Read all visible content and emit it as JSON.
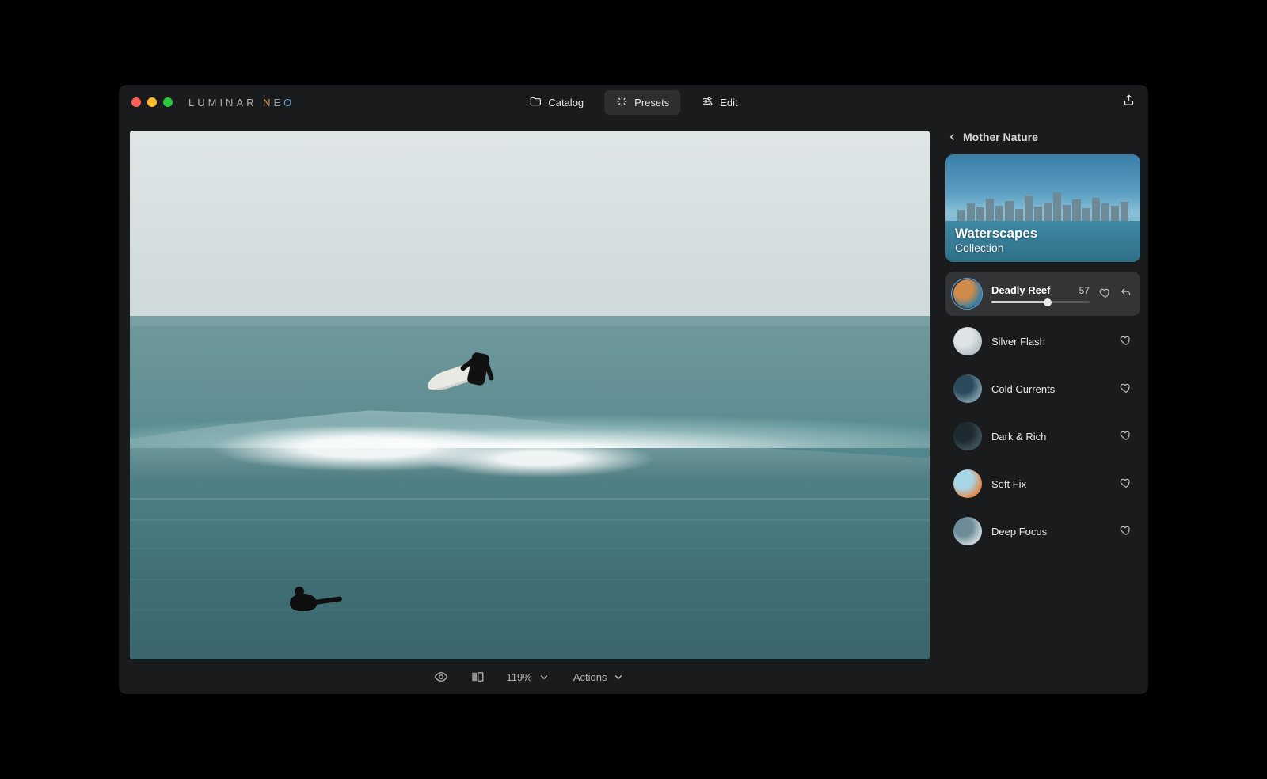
{
  "app": {
    "name": "LUMINAR NEO"
  },
  "tabs": {
    "catalog": "Catalog",
    "presets": "Presets",
    "edit": "Edit",
    "active": "presets"
  },
  "panel": {
    "back_label": "Mother Nature",
    "collection_title": "Waterscapes",
    "collection_subtitle": "Collection"
  },
  "presets": [
    {
      "name": "Deadly Reef",
      "value": 57,
      "selected": true,
      "thumb_colors": [
        "#d08a4a",
        "#3b7fa2"
      ]
    },
    {
      "name": "Silver Flash",
      "value": null,
      "selected": false,
      "thumb_colors": [
        "#dfe3e5",
        "#b9c3c8"
      ]
    },
    {
      "name": "Cold Currents",
      "value": null,
      "selected": false,
      "thumb_colors": [
        "#2b4a5c",
        "#7a97a6"
      ]
    },
    {
      "name": "Dark & Rich",
      "value": null,
      "selected": false,
      "thumb_colors": [
        "#1d2a30",
        "#3e5058"
      ]
    },
    {
      "name": "Soft Fix",
      "value": null,
      "selected": false,
      "thumb_colors": [
        "#a7d7e6",
        "#e08f5a"
      ]
    },
    {
      "name": "Deep Focus",
      "value": null,
      "selected": false,
      "thumb_colors": [
        "#6e8c98",
        "#c6d4da"
      ]
    }
  ],
  "bottom": {
    "zoom": "119%",
    "actions_label": "Actions"
  },
  "icons": {
    "share": "share-icon",
    "eye": "eye-icon",
    "compare": "compare-icon",
    "chevron_down": "chevron-down-icon",
    "chevron_left": "chevron-left-icon",
    "heart": "heart-icon",
    "undo": "undo-icon",
    "folder": "folder-icon",
    "sparkle": "sparkle-icon",
    "sliders": "sliders-icon"
  }
}
